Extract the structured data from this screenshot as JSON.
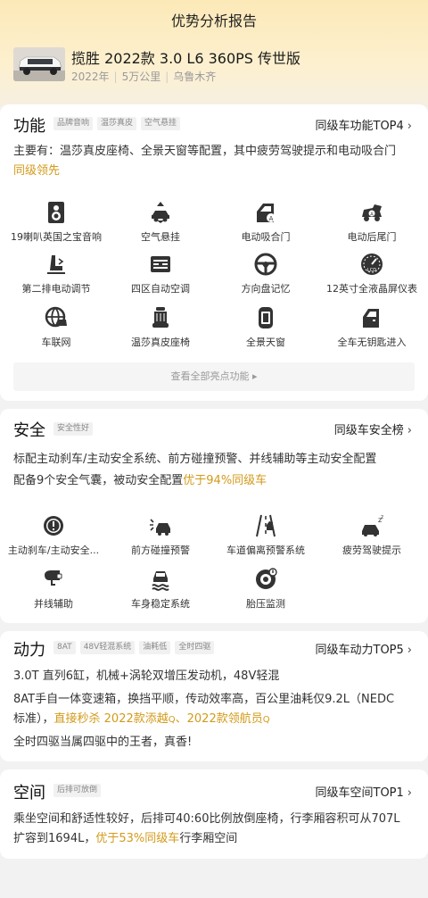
{
  "header": {
    "title": "优势分析报告",
    "car_name": "揽胜 2022款 3.0 L6 360PS 传世版",
    "meta": [
      "2022年",
      "5万公里",
      "乌鲁木齐"
    ]
  },
  "function": {
    "title": "功能",
    "tags": [
      "品牌音响",
      "温莎真皮",
      "空气悬挂"
    ],
    "rank": "同级车功能TOP4",
    "summary_prefix": "主要有：温莎真皮座椅、全景天窗等配置，其中疲劳驾驶提示和电动吸合门",
    "summary_highlight": "同级领先",
    "features": [
      {
        "label": "19喇叭英国之宝音响",
        "icon": "speaker-icon"
      },
      {
        "label": "空气悬挂",
        "icon": "air-suspension-icon"
      },
      {
        "label": "电动吸合门",
        "icon": "soft-close-door-icon"
      },
      {
        "label": "电动后尾门",
        "icon": "power-tailgate-icon"
      },
      {
        "label": "第二排电动调节",
        "icon": "seat-adjust-icon"
      },
      {
        "label": "四区自动空调",
        "icon": "climate-control-icon"
      },
      {
        "label": "方向盘记忆",
        "icon": "steering-wheel-icon"
      },
      {
        "label": "12英寸全液晶屏仪表",
        "icon": "lcd-gauge-icon"
      },
      {
        "label": "车联网",
        "icon": "connected-car-icon"
      },
      {
        "label": "温莎真皮座椅",
        "icon": "leather-seat-icon"
      },
      {
        "label": "全景天窗",
        "icon": "panoramic-roof-icon"
      },
      {
        "label": "全车无钥匙进入",
        "icon": "keyless-entry-icon"
      }
    ],
    "view_all": "查看全部亮点功能 ▸"
  },
  "safety": {
    "title": "安全",
    "tags": [
      "安全性好"
    ],
    "rank": "同级车安全榜",
    "line1": "标配主动刹车/主动安全系统、前方碰撞预警、并线辅助等主动安全配置",
    "line2_prefix": "配备9个安全气囊，被动安全配置",
    "line2_highlight": "优于94%同级车",
    "features": [
      {
        "label": "主动刹车/主动安全...",
        "icon": "active-brake-icon"
      },
      {
        "label": "前方碰撞预警",
        "icon": "collision-warning-icon"
      },
      {
        "label": "车道偏离预警系统",
        "icon": "lane-departure-icon"
      },
      {
        "label": "疲劳驾驶提示",
        "icon": "fatigue-alert-icon"
      },
      {
        "label": "并线辅助",
        "icon": "blind-spot-icon"
      },
      {
        "label": "车身稳定系统",
        "icon": "stability-control-icon"
      },
      {
        "label": "胎压监测",
        "icon": "tire-pressure-icon"
      }
    ]
  },
  "power": {
    "title": "动力",
    "tags": [
      "8AT",
      "48V轻混系统",
      "油耗低",
      "全时四驱"
    ],
    "rank": "同级车动力TOP5",
    "line1": "3.0T 直列6缸，机械+涡轮双增压发动机，48V轻混",
    "line2": "8AT手自一体变速箱，换挡平顺，传动效率高，百公里油耗仅9.2L（NEDC",
    "line3_prefix": "标准），",
    "line3_highlight": "直接秒杀 2022款添越",
    "line3_mid": "、",
    "line3_highlight2": "2022款领航员",
    "line4": "全时四驱当属四驱中的王者，真香!"
  },
  "space": {
    "title": "空间",
    "tags": [
      "后排可放倒"
    ],
    "rank": "同级车空间TOP1",
    "line1": "乘坐空间和舒适性较好，后排可40:60比例放倒座椅，行李厢容积可从707L",
    "line2_prefix": "扩容到1694L，",
    "line2_highlight": "优于53%同级车",
    "line2_suffix": "行李厢空间"
  },
  "colors": {
    "accent": "#d39a1a"
  }
}
